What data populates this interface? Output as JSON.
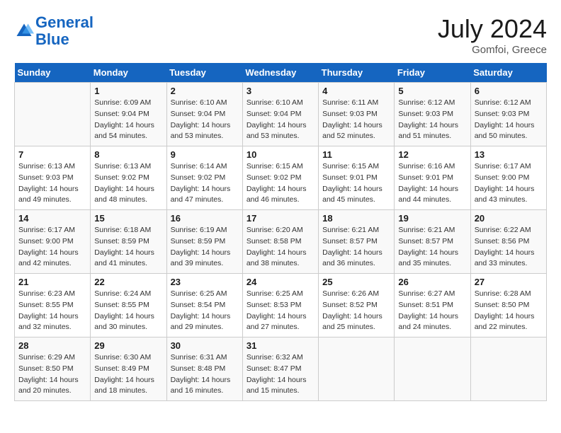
{
  "header": {
    "logo_line1": "General",
    "logo_line2": "Blue",
    "month_year": "July 2024",
    "location": "Gomfoi, Greece"
  },
  "days_of_week": [
    "Sunday",
    "Monday",
    "Tuesday",
    "Wednesday",
    "Thursday",
    "Friday",
    "Saturday"
  ],
  "weeks": [
    [
      {
        "num": "",
        "sunrise": "",
        "sunset": "",
        "daylight": ""
      },
      {
        "num": "1",
        "sunrise": "Sunrise: 6:09 AM",
        "sunset": "Sunset: 9:04 PM",
        "daylight": "Daylight: 14 hours and 54 minutes."
      },
      {
        "num": "2",
        "sunrise": "Sunrise: 6:10 AM",
        "sunset": "Sunset: 9:04 PM",
        "daylight": "Daylight: 14 hours and 53 minutes."
      },
      {
        "num": "3",
        "sunrise": "Sunrise: 6:10 AM",
        "sunset": "Sunset: 9:04 PM",
        "daylight": "Daylight: 14 hours and 53 minutes."
      },
      {
        "num": "4",
        "sunrise": "Sunrise: 6:11 AM",
        "sunset": "Sunset: 9:03 PM",
        "daylight": "Daylight: 14 hours and 52 minutes."
      },
      {
        "num": "5",
        "sunrise": "Sunrise: 6:12 AM",
        "sunset": "Sunset: 9:03 PM",
        "daylight": "Daylight: 14 hours and 51 minutes."
      },
      {
        "num": "6",
        "sunrise": "Sunrise: 6:12 AM",
        "sunset": "Sunset: 9:03 PM",
        "daylight": "Daylight: 14 hours and 50 minutes."
      }
    ],
    [
      {
        "num": "7",
        "sunrise": "Sunrise: 6:13 AM",
        "sunset": "Sunset: 9:03 PM",
        "daylight": "Daylight: 14 hours and 49 minutes."
      },
      {
        "num": "8",
        "sunrise": "Sunrise: 6:13 AM",
        "sunset": "Sunset: 9:02 PM",
        "daylight": "Daylight: 14 hours and 48 minutes."
      },
      {
        "num": "9",
        "sunrise": "Sunrise: 6:14 AM",
        "sunset": "Sunset: 9:02 PM",
        "daylight": "Daylight: 14 hours and 47 minutes."
      },
      {
        "num": "10",
        "sunrise": "Sunrise: 6:15 AM",
        "sunset": "Sunset: 9:02 PM",
        "daylight": "Daylight: 14 hours and 46 minutes."
      },
      {
        "num": "11",
        "sunrise": "Sunrise: 6:15 AM",
        "sunset": "Sunset: 9:01 PM",
        "daylight": "Daylight: 14 hours and 45 minutes."
      },
      {
        "num": "12",
        "sunrise": "Sunrise: 6:16 AM",
        "sunset": "Sunset: 9:01 PM",
        "daylight": "Daylight: 14 hours and 44 minutes."
      },
      {
        "num": "13",
        "sunrise": "Sunrise: 6:17 AM",
        "sunset": "Sunset: 9:00 PM",
        "daylight": "Daylight: 14 hours and 43 minutes."
      }
    ],
    [
      {
        "num": "14",
        "sunrise": "Sunrise: 6:17 AM",
        "sunset": "Sunset: 9:00 PM",
        "daylight": "Daylight: 14 hours and 42 minutes."
      },
      {
        "num": "15",
        "sunrise": "Sunrise: 6:18 AM",
        "sunset": "Sunset: 8:59 PM",
        "daylight": "Daylight: 14 hours and 41 minutes."
      },
      {
        "num": "16",
        "sunrise": "Sunrise: 6:19 AM",
        "sunset": "Sunset: 8:59 PM",
        "daylight": "Daylight: 14 hours and 39 minutes."
      },
      {
        "num": "17",
        "sunrise": "Sunrise: 6:20 AM",
        "sunset": "Sunset: 8:58 PM",
        "daylight": "Daylight: 14 hours and 38 minutes."
      },
      {
        "num": "18",
        "sunrise": "Sunrise: 6:21 AM",
        "sunset": "Sunset: 8:57 PM",
        "daylight": "Daylight: 14 hours and 36 minutes."
      },
      {
        "num": "19",
        "sunrise": "Sunrise: 6:21 AM",
        "sunset": "Sunset: 8:57 PM",
        "daylight": "Daylight: 14 hours and 35 minutes."
      },
      {
        "num": "20",
        "sunrise": "Sunrise: 6:22 AM",
        "sunset": "Sunset: 8:56 PM",
        "daylight": "Daylight: 14 hours and 33 minutes."
      }
    ],
    [
      {
        "num": "21",
        "sunrise": "Sunrise: 6:23 AM",
        "sunset": "Sunset: 8:55 PM",
        "daylight": "Daylight: 14 hours and 32 minutes."
      },
      {
        "num": "22",
        "sunrise": "Sunrise: 6:24 AM",
        "sunset": "Sunset: 8:55 PM",
        "daylight": "Daylight: 14 hours and 30 minutes."
      },
      {
        "num": "23",
        "sunrise": "Sunrise: 6:25 AM",
        "sunset": "Sunset: 8:54 PM",
        "daylight": "Daylight: 14 hours and 29 minutes."
      },
      {
        "num": "24",
        "sunrise": "Sunrise: 6:25 AM",
        "sunset": "Sunset: 8:53 PM",
        "daylight": "Daylight: 14 hours and 27 minutes."
      },
      {
        "num": "25",
        "sunrise": "Sunrise: 6:26 AM",
        "sunset": "Sunset: 8:52 PM",
        "daylight": "Daylight: 14 hours and 25 minutes."
      },
      {
        "num": "26",
        "sunrise": "Sunrise: 6:27 AM",
        "sunset": "Sunset: 8:51 PM",
        "daylight": "Daylight: 14 hours and 24 minutes."
      },
      {
        "num": "27",
        "sunrise": "Sunrise: 6:28 AM",
        "sunset": "Sunset: 8:50 PM",
        "daylight": "Daylight: 14 hours and 22 minutes."
      }
    ],
    [
      {
        "num": "28",
        "sunrise": "Sunrise: 6:29 AM",
        "sunset": "Sunset: 8:50 PM",
        "daylight": "Daylight: 14 hours and 20 minutes."
      },
      {
        "num": "29",
        "sunrise": "Sunrise: 6:30 AM",
        "sunset": "Sunset: 8:49 PM",
        "daylight": "Daylight: 14 hours and 18 minutes."
      },
      {
        "num": "30",
        "sunrise": "Sunrise: 6:31 AM",
        "sunset": "Sunset: 8:48 PM",
        "daylight": "Daylight: 14 hours and 16 minutes."
      },
      {
        "num": "31",
        "sunrise": "Sunrise: 6:32 AM",
        "sunset": "Sunset: 8:47 PM",
        "daylight": "Daylight: 14 hours and 15 minutes."
      },
      {
        "num": "",
        "sunrise": "",
        "sunset": "",
        "daylight": ""
      },
      {
        "num": "",
        "sunrise": "",
        "sunset": "",
        "daylight": ""
      },
      {
        "num": "",
        "sunrise": "",
        "sunset": "",
        "daylight": ""
      }
    ]
  ]
}
